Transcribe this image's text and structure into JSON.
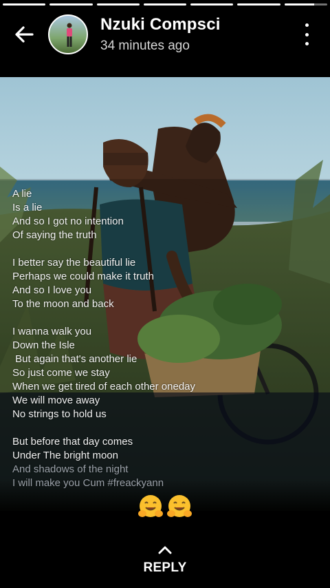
{
  "status": {
    "segments": [
      1,
      1,
      1,
      1,
      1,
      1,
      0.7
    ]
  },
  "header": {
    "name": "Nzuki Compsci",
    "time": "34 minutes ago"
  },
  "caption": {
    "lines": [
      "A lie",
      "Is a lie",
      "And so I got no intention",
      "Of saying the truth",
      "",
      "I better say the beautiful lie",
      "Perhaps we could make it truth",
      "And so I love you",
      "To the moon and back",
      "",
      "I wanna walk you",
      "Down the Isle",
      " But again that's another lie",
      "So just come we stay",
      "When we get tired of each other oneday",
      "We will move away",
      "No strings to hold us",
      "",
      "But before that day comes",
      "Under The bright moon",
      "And shadows of the night",
      "I will make you Cum #freackyann"
    ]
  },
  "reactions": {
    "emojis": [
      "hugging-face",
      "hugging-face"
    ]
  },
  "reply": {
    "label": "REPLY"
  }
}
